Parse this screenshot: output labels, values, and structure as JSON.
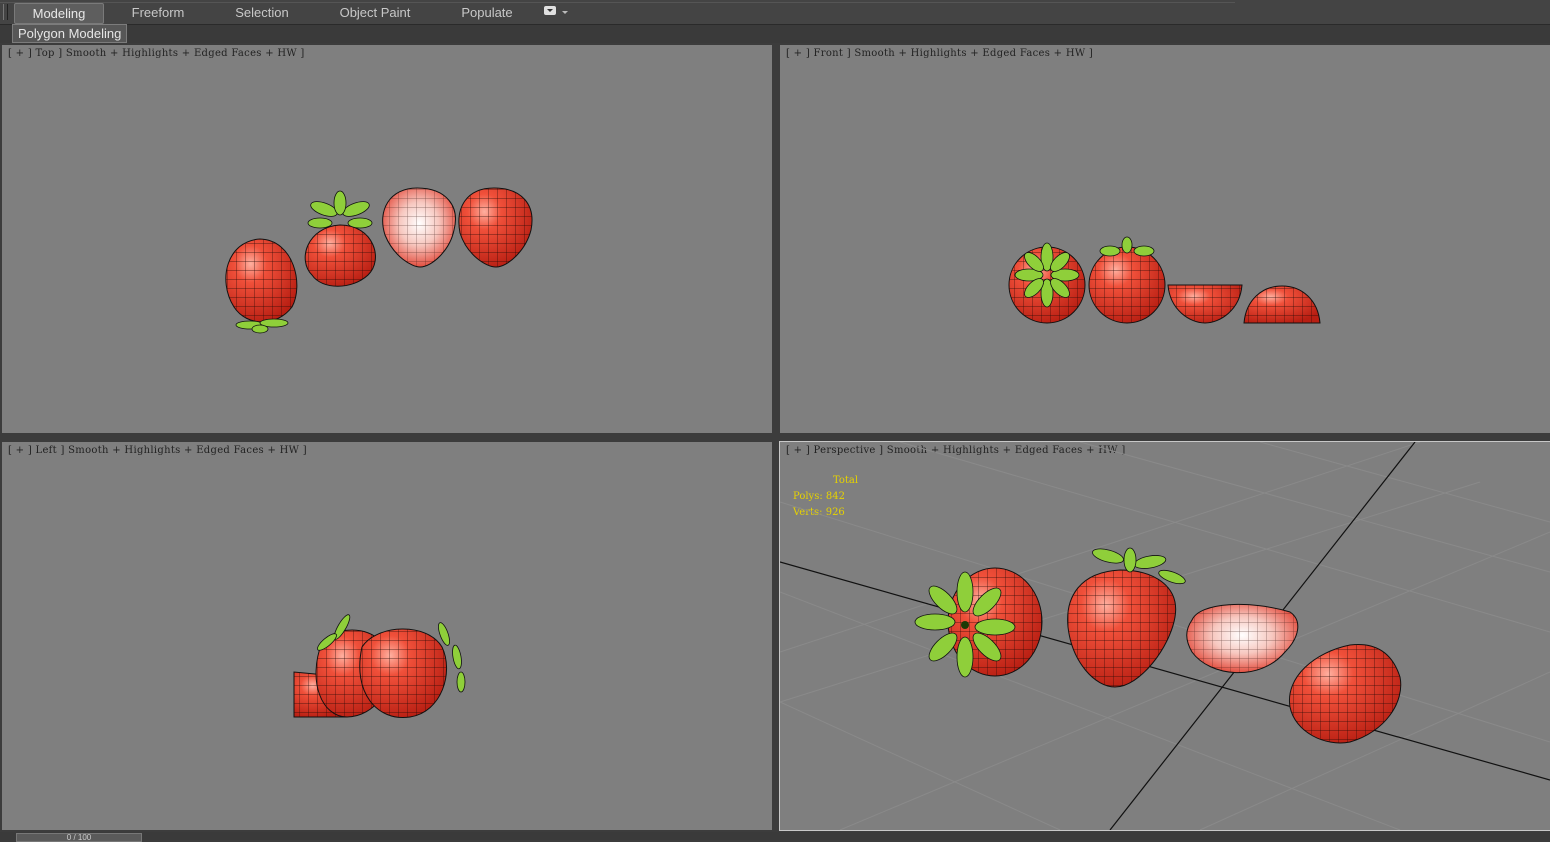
{
  "ribbon_tabs": [
    {
      "label": "Modeling",
      "active": true
    },
    {
      "label": "Freeform",
      "active": false
    },
    {
      "label": "Selection",
      "active": false
    },
    {
      "label": "Object Paint",
      "active": false
    },
    {
      "label": "Populate",
      "active": false
    }
  ],
  "ribbon_panel": {
    "label": "Polygon Modeling"
  },
  "viewports": {
    "top": {
      "label": "[ + ] Top ] Smooth + Highlights + Edged Faces + HW ]"
    },
    "front": {
      "label": "[ + ] Front ] Smooth + Highlights + Edged Faces + HW ]"
    },
    "left": {
      "label": "[ + ] Left ] Smooth + Highlights + Edged Faces + HW ]"
    },
    "perspective": {
      "label": "[ + ] Perspective ] Smooth + Highlights + Edged Faces + HW ]",
      "stats": {
        "header": "Total",
        "polys": "Polys: 842",
        "verts": "Verts: 926"
      }
    }
  },
  "time_slider": {
    "label": "0 / 100"
  },
  "colors": {
    "viewport_bg": "#7f7f7f",
    "strawberry": "#e8392a",
    "leaf": "#8fcf3a",
    "stats_text": "#e6d200"
  },
  "icons": [
    "ribbon-dropdown-icon",
    "viewport-menu-icon"
  ]
}
